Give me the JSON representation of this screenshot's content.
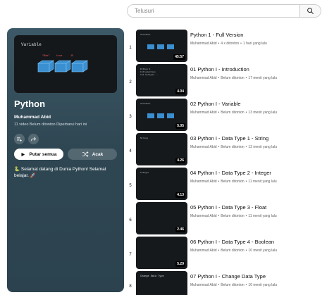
{
  "search": {
    "placeholder": "Telusuri"
  },
  "playlist": {
    "title": "Python",
    "owner": "Muhammad Abid",
    "meta": "11 video  Belum ditonton  Diperbarui hari ini",
    "play_all": "Putar semua",
    "shuffle": "Acak",
    "description": "🐍 Selamat datang di Dunia Python!  Selamat belajar. 🚀",
    "thumb_title": "Variable",
    "thumb_labels": [
      "\"Bob\"",
      "true",
      "15"
    ]
  },
  "videos": [
    {
      "index": "1",
      "title": "Python 1 - Full Version",
      "channel": "Muhammad Abid",
      "views": "4 x ditonton",
      "age": "1 hari yang lalu",
      "duration": "45:57",
      "thumb_text": "Variable"
    },
    {
      "index": "2",
      "title": "01 Python I - Introduction",
      "channel": "Muhammad Abid",
      "views": "Belum ditonton",
      "age": "17 menit yang lalu",
      "duration": "4.04",
      "thumb_text": "Python I\nIntroduction\nYuk belajar..."
    },
    {
      "index": "3",
      "title": "02 Python I - Variable",
      "channel": "Muhammad Abid",
      "views": "Belum ditonton",
      "age": "13 menit yang lalu",
      "duration": "5.05",
      "thumb_text": "Variable"
    },
    {
      "index": "4",
      "title": "03 Python I - Data Type 1 - String",
      "channel": "Muhammad Abid",
      "views": "Belum ditonton",
      "age": "12 menit yang lalu",
      "duration": "4.26",
      "thumb_text": "String"
    },
    {
      "index": "5",
      "title": "04 Python I - Data Type 2 - Integer",
      "channel": "Muhammad Abid",
      "views": "Belum ditonton",
      "age": "11 menit yang lalu",
      "duration": "4.13",
      "thumb_text": "Integer"
    },
    {
      "index": "6",
      "title": "05 Python I - Data Type 3 - Float",
      "channel": "Muhammad Abid",
      "views": "Belum ditonton",
      "age": "11 menit yang lalu",
      "duration": "2.46",
      "thumb_text": ""
    },
    {
      "index": "7",
      "title": "06 Python I - Data Type 4 - Boolean",
      "channel": "Muhammad Abid",
      "views": "Belum ditonton",
      "age": "10 menit yang lalu",
      "duration": "5.29",
      "thumb_text": ""
    },
    {
      "index": "8",
      "title": "07 Python I - Change Data Type",
      "channel": "Muhammad Abid",
      "views": "Belum ditonton",
      "age": "10 menit yang lalu",
      "duration": "",
      "thumb_text": "Change Data Type"
    }
  ],
  "colors": {
    "panel": "#2f4753",
    "thumb_bg": "#16191c",
    "accent_blue": "#3ea6ff"
  },
  "icons": {
    "search": "search-icon",
    "add_to_playlist": "playlist-add-icon",
    "share": "share-icon",
    "play": "play-icon",
    "shuffle": "shuffle-icon"
  }
}
